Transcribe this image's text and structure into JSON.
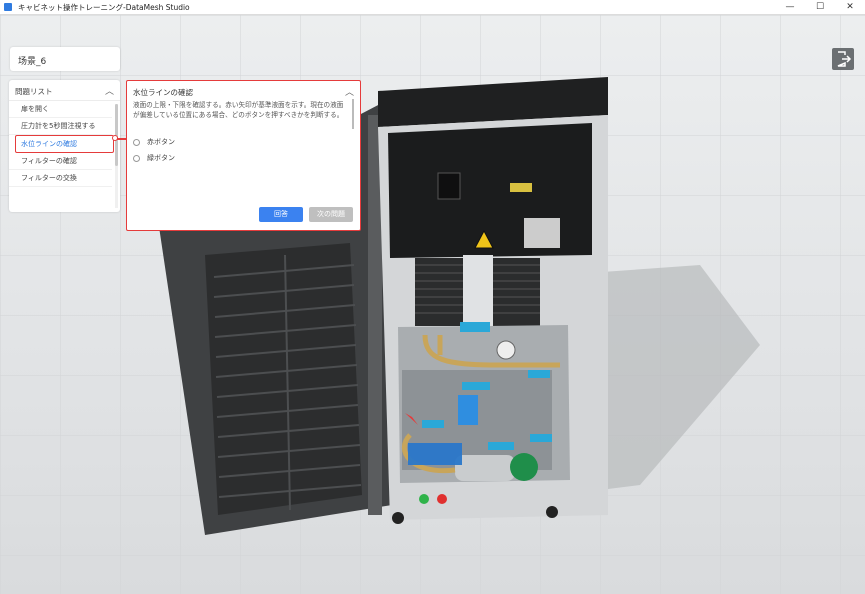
{
  "window": {
    "title": "キャビネット操作トレーニング-DataMesh Studio",
    "controls": [
      "—",
      "☐",
      "✕"
    ]
  },
  "scene": {
    "name": "场景_6"
  },
  "question_list": {
    "header": "問題リスト",
    "items": [
      {
        "label": "扉を開く"
      },
      {
        "label": "圧力計を5秒間注視する"
      },
      {
        "label": "水位ラインの確認"
      },
      {
        "label": "フィルターの確認"
      },
      {
        "label": "フィルターの交換"
      }
    ],
    "active_index": 2
  },
  "question": {
    "title": "水位ラインの確認",
    "body": "液面の上限・下限を確認する。赤い矢印が基準液面を示す。現在の液面が偏差している位置にある場合、どのボタンを押すべきかを判断する。",
    "options": [
      {
        "label": "赤ボタン"
      },
      {
        "label": "緑ボタン"
      }
    ],
    "answer_button": "回答",
    "next_button": "次の問題"
  },
  "icons": {
    "exit": "exit-icon",
    "collapse": "chevron-up-icon",
    "warning": "warning-icon"
  },
  "colors": {
    "accent": "#2f7be0",
    "highlight": "#e53b3b",
    "tag": "#2aa8d8"
  }
}
